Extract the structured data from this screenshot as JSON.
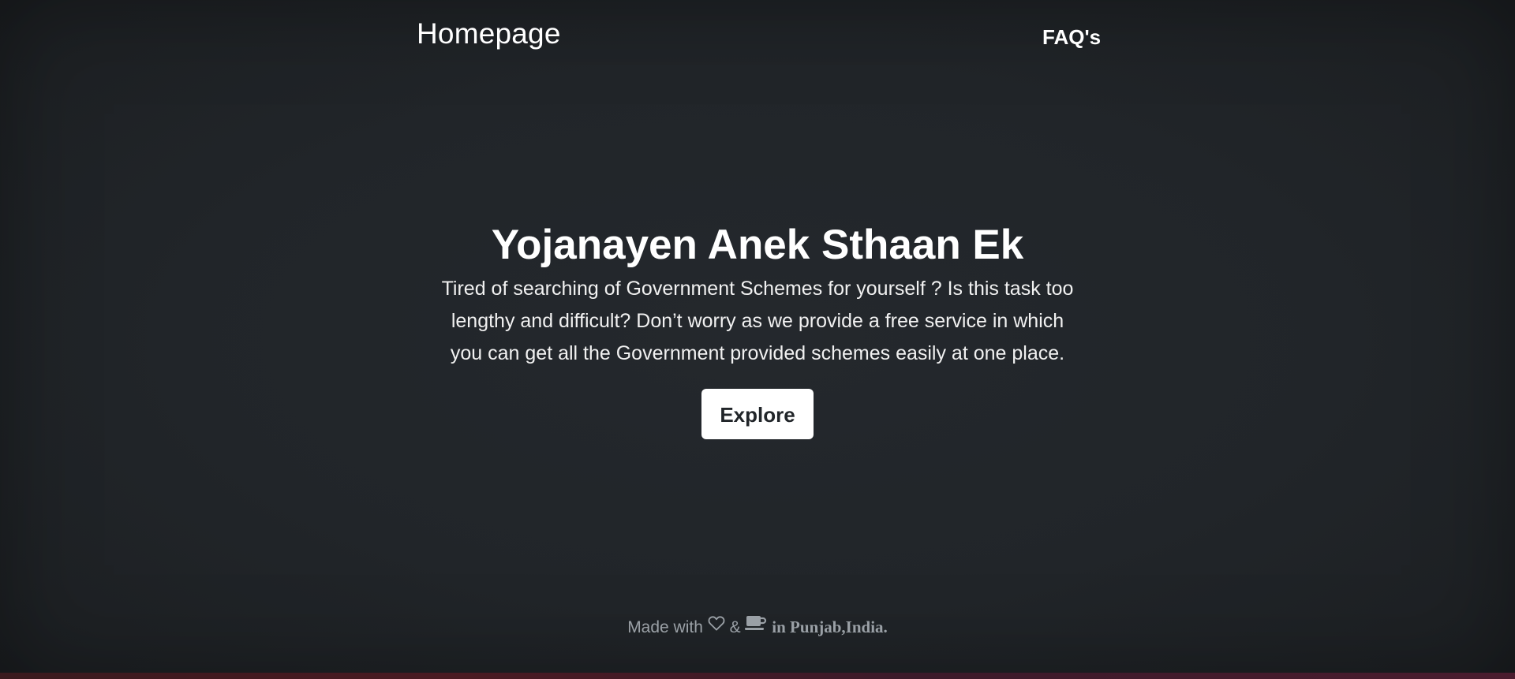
{
  "header": {
    "brand": "Homepage",
    "nav_faq": "FAQ's"
  },
  "hero": {
    "title": "Yojanayen Anek Sthaan Ek",
    "description": "Tired of searching of Government Schemes for yourself ? Is this task too lengthy and difficult? Don’t worry as we provide a free service in which you can get all the Government provided schemes easily at one place.",
    "explore_label": "Explore"
  },
  "footer": {
    "made_with": "Made with",
    "amp": "&",
    "place": "in Punjab,India.",
    "icons": [
      "heart-icon",
      "coffee-cup-icon"
    ]
  },
  "colors": {
    "background": "#212529",
    "text": "#ffffff",
    "button_bg": "#ffffff",
    "button_text": "#212529",
    "footer_text": "#9aa0a6"
  }
}
